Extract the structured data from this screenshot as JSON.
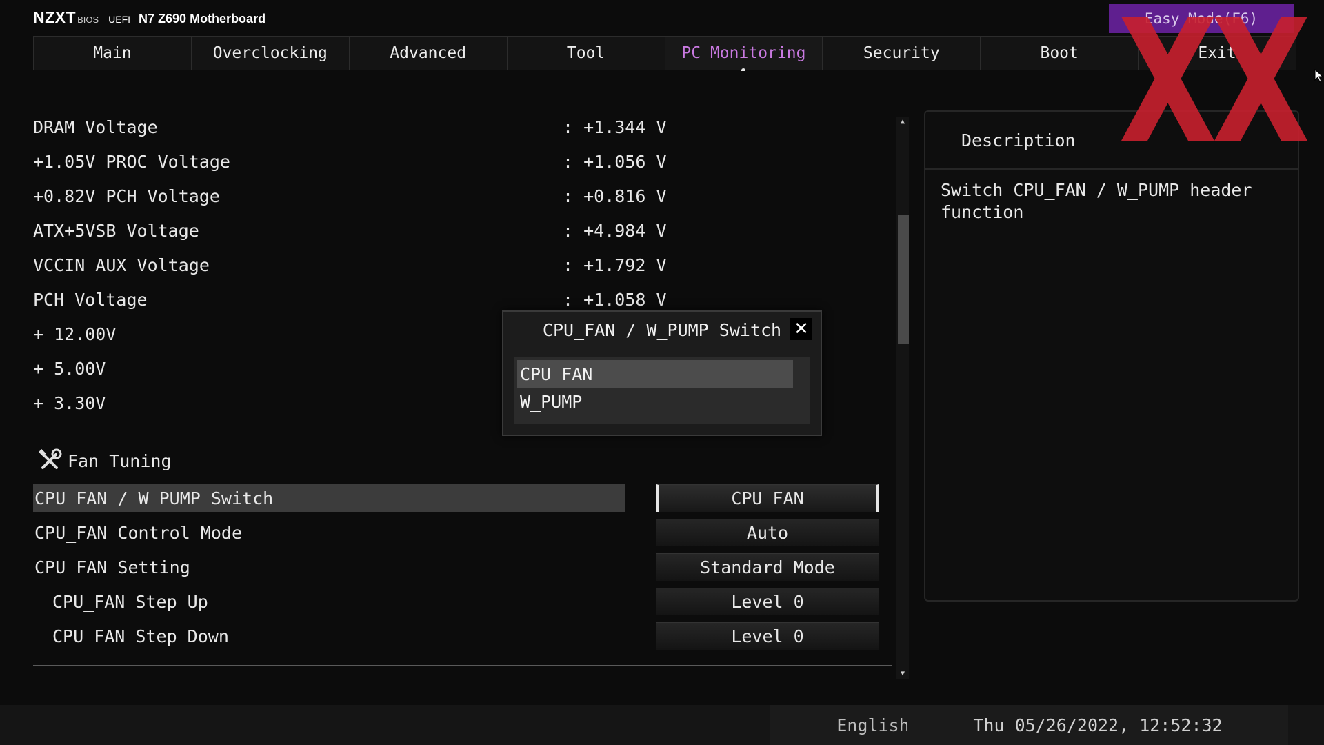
{
  "header": {
    "brand": "NZXT",
    "bios_label": "BIOS",
    "uefi_label": "UEFI",
    "board_name": "N7 Z690 Motherboard",
    "easy_mode_button": "Easy Mode(F6)"
  },
  "tabs": [
    {
      "label": "Main"
    },
    {
      "label": "Overclocking"
    },
    {
      "label": "Advanced"
    },
    {
      "label": "Tool"
    },
    {
      "label": "PC Monitoring",
      "active": true
    },
    {
      "label": "Security"
    },
    {
      "label": "Boot"
    },
    {
      "label": "Exit"
    }
  ],
  "monitoring": [
    {
      "label": "DRAM Voltage",
      "value": ": +1.344 V"
    },
    {
      "label": "+1.05V PROC Voltage",
      "value": ": +1.056 V"
    },
    {
      "label": "+0.82V PCH Voltage",
      "value": ": +0.816 V"
    },
    {
      "label": "ATX+5VSB Voltage",
      "value": ": +4.984 V"
    },
    {
      "label": "VCCIN AUX Voltage",
      "value": ": +1.792 V"
    },
    {
      "label": "PCH Voltage",
      "value": ": +1.058 V"
    },
    {
      "label": "+ 12.00V",
      "value": ""
    },
    {
      "label": "+ 5.00V",
      "value": ""
    },
    {
      "label": "+ 3.30V",
      "value": ""
    }
  ],
  "fan_tuning": {
    "title": "Fan Tuning",
    "icon": "wrench-screwdriver-icon",
    "settings": [
      {
        "label": "CPU_FAN / W_PUMP Switch",
        "value": "CPU_FAN",
        "selected": true
      },
      {
        "label": "CPU_FAN Control Mode",
        "value": "Auto"
      },
      {
        "label": "CPU_FAN Setting",
        "value": "Standard Mode"
      },
      {
        "label": "CPU_FAN Step Up",
        "value": "Level 0",
        "indented": true
      },
      {
        "label": "CPU_FAN Step Down",
        "value": "Level 0",
        "indented": true
      }
    ]
  },
  "description": {
    "title": "Description",
    "text": "Switch CPU_FAN / W_PUMP header function"
  },
  "popup": {
    "title": "CPU_FAN / W_PUMP Switch",
    "close_icon": "close-icon",
    "options": [
      "CPU_FAN",
      "W_PUMP"
    ],
    "highlighted_index": 0
  },
  "footer": {
    "language": "English",
    "datetime": "Thu 05/26/2022, 12:52:32"
  },
  "colors": {
    "accent_purple": "#c879e0",
    "easy_mode_bg": "#5f1f8f",
    "watermark_red": "#c8202e"
  }
}
